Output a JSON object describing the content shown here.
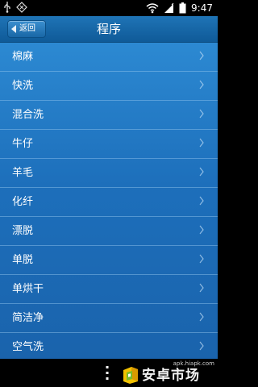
{
  "status_bar": {
    "time": "9:47"
  },
  "title_bar": {
    "back_label": "返回",
    "title": "程序"
  },
  "list": {
    "items": [
      {
        "label": "棉麻"
      },
      {
        "label": "快洗"
      },
      {
        "label": "混合洗"
      },
      {
        "label": "牛仔"
      },
      {
        "label": "羊毛"
      },
      {
        "label": "化纤"
      },
      {
        "label": "漂脱"
      },
      {
        "label": "单脱"
      },
      {
        "label": "单烘干"
      },
      {
        "label": "简洁净"
      },
      {
        "label": "空气洗"
      }
    ]
  },
  "bottom_bar": {
    "watermark_url": "apk.hiapk.com",
    "logo_text": "安卓市场"
  },
  "colors": {
    "title_bar": "#1f74b6",
    "list_background": "#2c89d2",
    "logo_yellow": "#f2c200",
    "logo_green": "#7bbb2a"
  }
}
